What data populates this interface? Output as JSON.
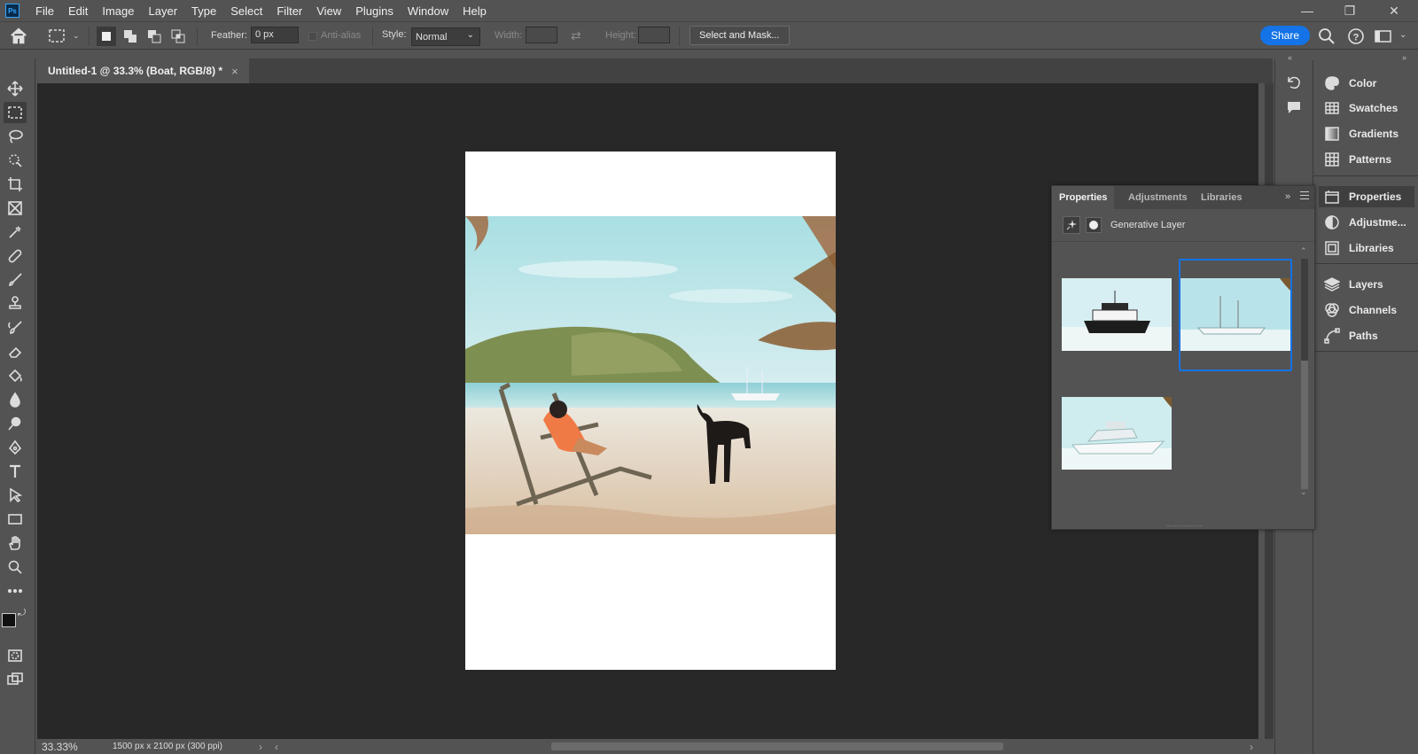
{
  "app": {
    "logo_text": "Ps"
  },
  "menu": [
    "File",
    "Edit",
    "Image",
    "Layer",
    "Type",
    "Select",
    "Filter",
    "View",
    "Plugins",
    "Window",
    "Help"
  ],
  "window_controls": {
    "minimize": "—",
    "restore": "❐",
    "close": "✕"
  },
  "options_bar": {
    "feather_label": "Feather:",
    "feather_value": "0 px",
    "anti_alias_label": "Anti-alias",
    "style_label": "Style:",
    "style_value": "Normal",
    "width_label": "Width:",
    "height_label": "Height:",
    "select_and_mask_label": "Select and Mask...",
    "share_label": "Share"
  },
  "document_tab": {
    "title": "Untitled-1 @ 33.3% (Boat, RGB/8) *",
    "close": "×"
  },
  "status_bar": {
    "zoom": "33.33%",
    "doc_info": "1500 px x 2100 px (300 ppi)",
    "next": "›",
    "prev": "‹"
  },
  "properties_panel": {
    "tabs": [
      "Properties",
      "Adjustments",
      "Libraries"
    ],
    "active_tab": "Properties",
    "layer_type": "Generative Layer",
    "variations_selected_index": 1
  },
  "right_dock": {
    "group1": [
      "Color",
      "Swatches",
      "Gradients",
      "Patterns"
    ],
    "group2": [
      "Properties",
      "Adjustme...",
      "Libraries"
    ],
    "group3": [
      "Layers",
      "Channels",
      "Paths"
    ],
    "active_item": "Properties"
  },
  "colors": {
    "accent": "#1473e6",
    "panel_bg": "#535353",
    "canvas_bg": "#282828"
  }
}
